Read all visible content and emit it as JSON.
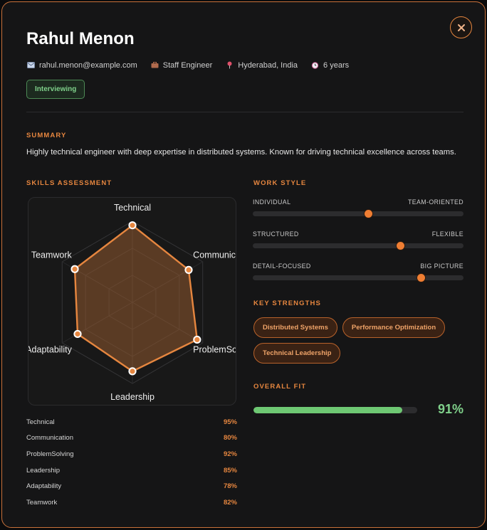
{
  "profile": {
    "name": "Rahul Menon",
    "email": "rahul.menon@example.com",
    "title": "Staff Engineer",
    "location": "Hyderabad, India",
    "experience": "6 years",
    "status": "Interviewing"
  },
  "icons": {
    "close": "close-icon",
    "email": "email-icon",
    "title": "briefcase-icon",
    "location": "pin-icon",
    "experience": "clock-icon"
  },
  "sections": {
    "summary": "SUMMARY",
    "skills": "SKILLS ASSESSMENT",
    "work_style": "WORK STYLE",
    "strengths": "KEY STRENGTHS",
    "fit": "OVERALL FIT"
  },
  "summary": "Highly technical engineer with deep expertise in distributed systems. Known for driving technical excellence across teams.",
  "chart_data": {
    "type": "radar",
    "axes": [
      "Technical",
      "Communication",
      "ProblemSolving",
      "Leadership",
      "Adaptability",
      "Teamwork"
    ],
    "axis_labels_displayed": [
      "Technical",
      "Communicatic",
      "ProblemSolvir",
      "Leadership",
      "Adaptability",
      "Teamwork"
    ],
    "values": [
      95,
      80,
      92,
      85,
      78,
      82
    ],
    "range": [
      0,
      100
    ],
    "rings": 3,
    "color": "#e6863f"
  },
  "skills": [
    {
      "name": "Technical",
      "value": "95%"
    },
    {
      "name": "Communication",
      "value": "80%"
    },
    {
      "name": "ProblemSolving",
      "value": "92%"
    },
    {
      "name": "Leadership",
      "value": "85%"
    },
    {
      "name": "Adaptability",
      "value": "78%"
    },
    {
      "name": "Teamwork",
      "value": "82%"
    }
  ],
  "work_style": [
    {
      "left": "INDIVIDUAL",
      "right": "TEAM-ORIENTED",
      "level": 0.55
    },
    {
      "left": "STRUCTURED",
      "right": "FLEXIBLE",
      "level": 0.7
    },
    {
      "left": "DETAIL-FOCUSED",
      "right": "BIG PICTURE",
      "level": 0.8
    }
  ],
  "strengths": [
    "Distributed Systems",
    "Performance Optimization",
    "Technical Leadership"
  ],
  "overall_fit": {
    "value": "91%",
    "level": 0.91
  },
  "colors": {
    "accent": "#e6863f",
    "success": "#7fd08a",
    "border": "#c9713a"
  }
}
